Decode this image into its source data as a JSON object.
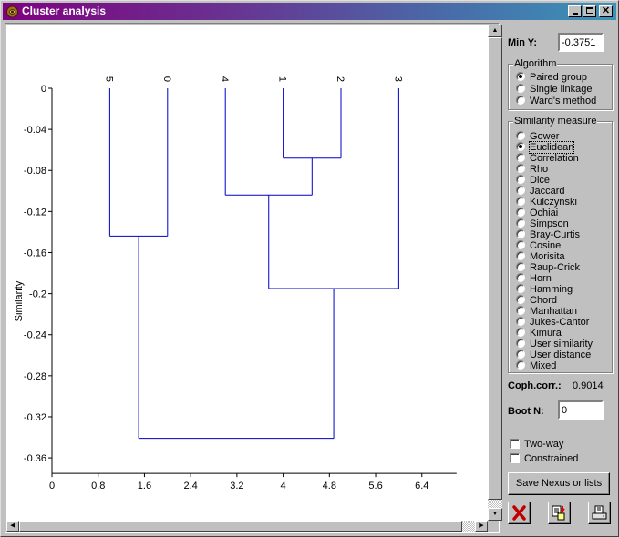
{
  "window": {
    "title": "Cluster analysis",
    "controls": {
      "minimize": "_",
      "maximize": "□",
      "close": "×"
    }
  },
  "chart_data": {
    "type": "dendrogram",
    "title": "",
    "xlabel": "",
    "ylabel": "Similarity",
    "xlim": [
      0,
      7.0
    ],
    "ylim": [
      -0.3751,
      0
    ],
    "x_ticks": [
      0,
      0.8,
      1.6,
      2.4,
      3.2,
      4,
      4.8,
      5.6,
      6.4
    ],
    "x_tick_labels": [
      "0",
      "0.8",
      "1.6",
      "2.4",
      "3.2",
      "4",
      "4.8",
      "5.6",
      "6.4"
    ],
    "y_ticks": [
      0,
      -0.04,
      -0.08,
      -0.12,
      -0.16,
      -0.2,
      -0.24,
      -0.28,
      -0.32,
      -0.36
    ],
    "y_tick_labels": [
      "0",
      "-0.04",
      "-0.08",
      "-0.12",
      "-0.16",
      "-0.2",
      "-0.24",
      "-0.28",
      "-0.32",
      "-0.36"
    ],
    "leaves": [
      {
        "label": "5",
        "x": 1
      },
      {
        "label": "0",
        "x": 2
      },
      {
        "label": "4",
        "x": 3
      },
      {
        "label": "1",
        "x": 4
      },
      {
        "label": "2",
        "x": 5
      },
      {
        "label": "3",
        "x": 6
      }
    ],
    "merges": [
      {
        "id": "m1",
        "children": [
          "1",
          "2"
        ],
        "similarity": -0.068
      },
      {
        "id": "m2",
        "children": [
          "4",
          "m1"
        ],
        "similarity": -0.104
      },
      {
        "id": "m3",
        "children": [
          "5",
          "0"
        ],
        "similarity": -0.144
      },
      {
        "id": "m4",
        "children": [
          "m2",
          "3"
        ],
        "similarity": -0.195
      },
      {
        "id": "m5",
        "children": [
          "m3",
          "m4"
        ],
        "similarity": -0.341
      }
    ],
    "line_color": "#0000cc",
    "grid": false
  },
  "panel": {
    "min_y_label": "Min Y:",
    "min_y_value": "-0.3751",
    "algorithm": {
      "title": "Algorithm",
      "options": [
        "Paired group",
        "Single linkage",
        "Ward's method"
      ],
      "selected": 0
    },
    "similarity": {
      "title": "Similarity measure",
      "options": [
        "Gower",
        "Euclidean",
        "Correlation",
        "Rho",
        "Dice",
        "Jaccard",
        "Kulczynski",
        "Ochiai",
        "Simpson",
        "Bray-Curtis",
        "Cosine",
        "Morisita",
        "Raup-Crick",
        "Horn",
        "Hamming",
        "Chord",
        "Manhattan",
        "Jukes-Cantor",
        "Kimura",
        "User similarity",
        "User distance",
        "Mixed"
      ],
      "selected": 1
    },
    "coph_label": "Coph.corr.:",
    "coph_value": "0.9014",
    "boot_label": "Boot N:",
    "boot_value": "0",
    "two_way_label": "Two-way",
    "two_way_checked": false,
    "constrained_label": "Constrained",
    "constrained_checked": false,
    "save_button": "Save Nexus or lists"
  }
}
